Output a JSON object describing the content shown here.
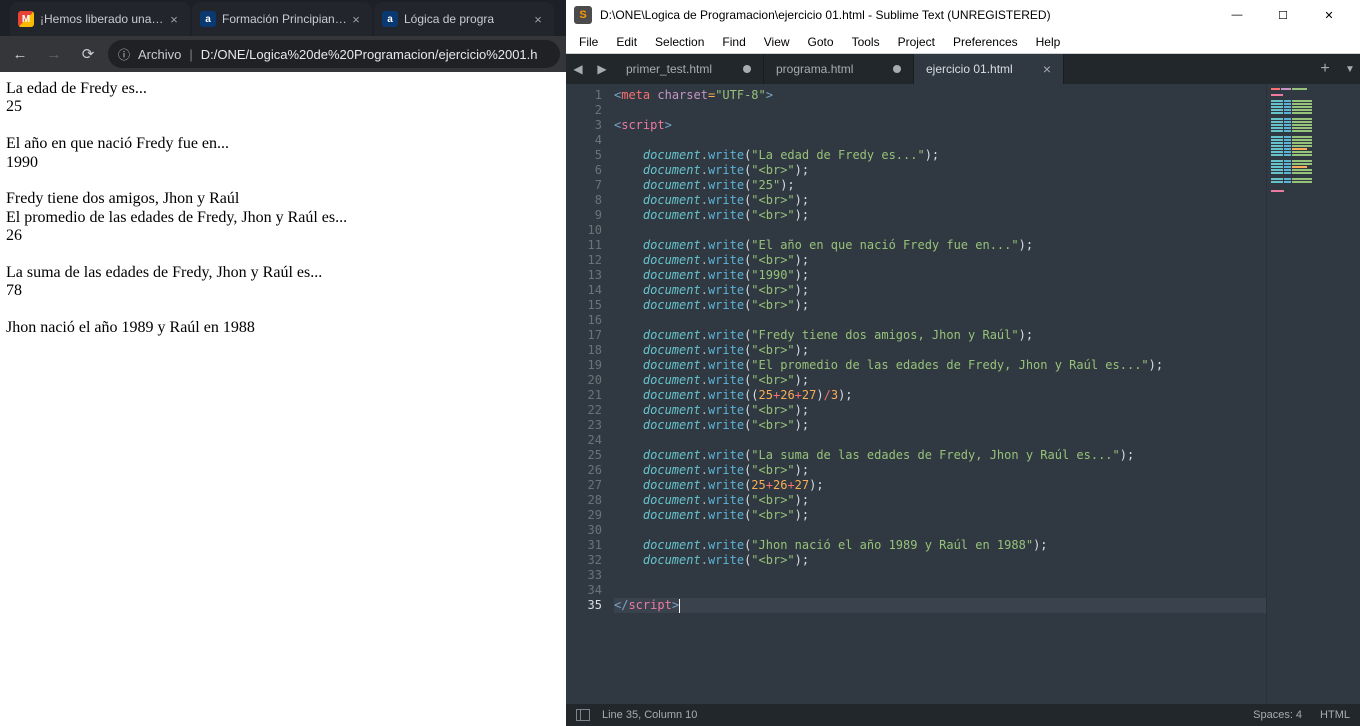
{
  "chrome": {
    "tabs": [
      {
        "label": "¡Hemos liberado una nueva f"
      },
      {
        "label": "Formación Principiante en Pr"
      },
      {
        "label": "Lógica de progra"
      }
    ],
    "url_label": "Archivo",
    "url_path": "D:/ONE/Logica%20de%20Programacion/ejercicio%2001.h",
    "content_lines": [
      "La edad de Fredy es...",
      "25",
      "",
      "El año en que nació Fredy fue en...",
      "1990",
      "",
      "Fredy tiene dos amigos, Jhon y Raúl",
      "El promedio de las edades de Fredy, Jhon y Raúl es...",
      "26",
      "",
      "La suma de las edades de Fredy, Jhon y Raúl es...",
      "78",
      "",
      "Jhon nació el año 1989 y Raúl en 1988"
    ]
  },
  "sublime": {
    "title": "D:\\ONE\\Logica de Programacion\\ejercicio 01.html - Sublime Text (UNREGISTERED)",
    "menu": [
      "File",
      "Edit",
      "Selection",
      "Find",
      "View",
      "Goto",
      "Tools",
      "Project",
      "Preferences",
      "Help"
    ],
    "tabs": [
      {
        "label": "primer_test.html",
        "dirty": true,
        "active": false
      },
      {
        "label": "programa.html",
        "dirty": true,
        "active": false
      },
      {
        "label": "ejercicio 01.html",
        "dirty": false,
        "active": true
      }
    ],
    "status": {
      "pos": "Line 35, Column 10",
      "spaces": "Spaces: 4",
      "lang": "HTML"
    },
    "code": [
      {
        "n": 1,
        "type": "metatag"
      },
      {
        "n": 2,
        "type": "blank"
      },
      {
        "n": 3,
        "type": "script-open"
      },
      {
        "n": 4,
        "type": "blank"
      },
      {
        "n": 5,
        "type": "dw-str",
        "str": "La edad de Fredy es..."
      },
      {
        "n": 6,
        "type": "dw-str",
        "str": "<br>"
      },
      {
        "n": 7,
        "type": "dw-str",
        "str": "25"
      },
      {
        "n": 8,
        "type": "dw-str",
        "str": "<br>"
      },
      {
        "n": 9,
        "type": "dw-str",
        "str": "<br>"
      },
      {
        "n": 10,
        "type": "blank"
      },
      {
        "n": 11,
        "type": "dw-str",
        "str": "El año en que nació Fredy fue en..."
      },
      {
        "n": 12,
        "type": "dw-str",
        "str": "<br>"
      },
      {
        "n": 13,
        "type": "dw-str",
        "str": "1990"
      },
      {
        "n": 14,
        "type": "dw-str",
        "str": "<br>"
      },
      {
        "n": 15,
        "type": "dw-str",
        "str": "<br>"
      },
      {
        "n": 16,
        "type": "blank"
      },
      {
        "n": 17,
        "type": "dw-str",
        "str": "Fredy tiene dos amigos, Jhon y Raúl"
      },
      {
        "n": 18,
        "type": "dw-str",
        "str": "<br>"
      },
      {
        "n": 19,
        "type": "dw-str",
        "str": "El promedio de las edades de Fredy, Jhon y Raúl es..."
      },
      {
        "n": 20,
        "type": "dw-str",
        "str": "<br>"
      },
      {
        "n": 21,
        "type": "dw-expr",
        "expr": [
          [
            "(",
            "p"
          ],
          [
            "(",
            "p"
          ],
          [
            "25",
            "n"
          ],
          [
            "+",
            "o"
          ],
          [
            "26",
            "n"
          ],
          [
            "+",
            "o"
          ],
          [
            "27",
            "n"
          ],
          [
            ")",
            "p"
          ],
          [
            "/",
            "o"
          ],
          [
            "3",
            "n"
          ],
          [
            ")",
            "p"
          ]
        ]
      },
      {
        "n": 22,
        "type": "dw-str",
        "str": "<br>"
      },
      {
        "n": 23,
        "type": "dw-str",
        "str": "<br>"
      },
      {
        "n": 24,
        "type": "blank"
      },
      {
        "n": 25,
        "type": "dw-str",
        "str": "La suma de las edades de Fredy, Jhon y Raúl es..."
      },
      {
        "n": 26,
        "type": "dw-str",
        "str": "<br>"
      },
      {
        "n": 27,
        "type": "dw-expr",
        "expr": [
          [
            "(",
            "p"
          ],
          [
            "25",
            "n"
          ],
          [
            "+",
            "o"
          ],
          [
            "26",
            "n"
          ],
          [
            "+",
            "o"
          ],
          [
            "27",
            "n"
          ],
          [
            ")",
            "p"
          ]
        ]
      },
      {
        "n": 28,
        "type": "dw-str",
        "str": "<br>"
      },
      {
        "n": 29,
        "type": "dw-str",
        "str": "<br>"
      },
      {
        "n": 30,
        "type": "blank"
      },
      {
        "n": 31,
        "type": "dw-str",
        "str": "Jhon nació el año 1989 y Raúl en 1988"
      },
      {
        "n": 32,
        "type": "dw-str",
        "str": "<br>"
      },
      {
        "n": 33,
        "type": "blank"
      },
      {
        "n": 34,
        "type": "blank"
      },
      {
        "n": 35,
        "type": "script-close",
        "current": true
      }
    ]
  }
}
